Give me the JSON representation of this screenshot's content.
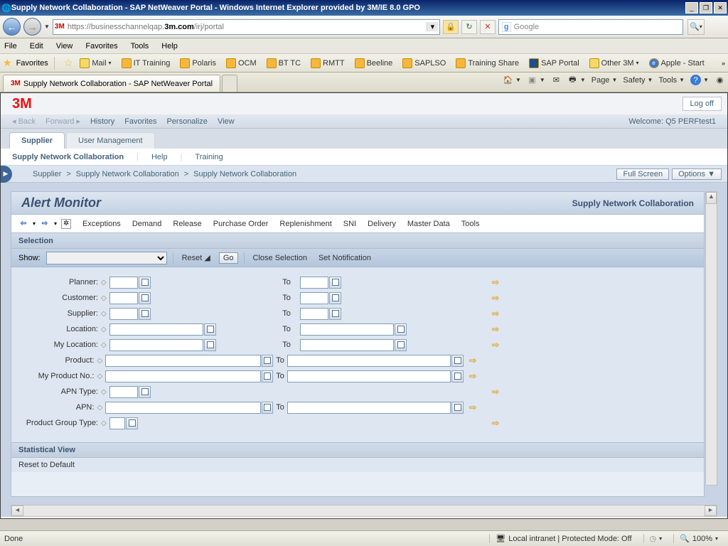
{
  "window": {
    "title": "Supply Network Collaboration - SAP NetWeaver Portal - Windows Internet Explorer provided by 3M/IE 8.0 GPO"
  },
  "address": {
    "logo_text": "3M",
    "protocol": "https://businesschannelqap.",
    "host": "3m.com",
    "path": "/irj/portal"
  },
  "search": {
    "provider": "Google",
    "glyph": "g"
  },
  "menubar": {
    "items": [
      "File",
      "Edit",
      "View",
      "Favorites",
      "Tools",
      "Help"
    ]
  },
  "favorites": {
    "label": "Favorites",
    "items": [
      "Mail",
      "IT Training",
      "Polaris",
      "OCM",
      "BT TC",
      "RMTT",
      "Beeline",
      "SAPLSO",
      "Training Share",
      "SAP Portal",
      "Other 3M",
      "Apple - Start"
    ]
  },
  "tab": {
    "title": "Supply Network Collaboration - SAP NetWeaver Portal",
    "logo": "3M"
  },
  "commandbar": {
    "page": "Page",
    "safety": "Safety",
    "tools": "Tools"
  },
  "portal": {
    "logo": "3M",
    "logoff": "Log off",
    "toolbar": {
      "back": "Back",
      "forward": "Forward",
      "history": "History",
      "favorites": "Favorites",
      "personalize": "Personalize",
      "view": "View",
      "welcome": "Welcome: Q5 PERFtest1"
    },
    "tabs": {
      "supplier": "Supplier",
      "user_mgmt": "User Management"
    },
    "subnav": {
      "snc": "Supply Network Collaboration",
      "help": "Help",
      "training": "Training"
    },
    "breadcrumb": {
      "a": "Supplier",
      "b": "Supply Network Collaboration",
      "c": "Supply Network Collaboration",
      "full": "Full Screen",
      "options": "Options"
    }
  },
  "app": {
    "title": "Alert Monitor",
    "corner": "Supply Network Collaboration",
    "menu": [
      "Exceptions",
      "Demand",
      "Release",
      "Purchase Order",
      "Replenishment",
      "SNI",
      "Delivery",
      "Master Data",
      "Tools"
    ],
    "selection_hdr": "Selection",
    "show_label": "Show:",
    "reset": "Reset",
    "go": "Go",
    "close_sel": "Close Selection",
    "set_notif": "Set Notification",
    "fields": {
      "planner": "Planner:",
      "customer": "Customer:",
      "supplier": "Supplier:",
      "location": "Location:",
      "mylocation": "My Location:",
      "product": "Product:",
      "myprodno": "My Product No.:",
      "apntype": "APN Type:",
      "apn": "APN:",
      "prodgrptype": "Product Group Type:",
      "to": "To"
    },
    "stat_hdr": "Statistical View",
    "reset_default": "Reset to Default"
  },
  "status": {
    "done": "Done",
    "zone": "Local intranet | Protected Mode: Off",
    "zoom": "100%"
  }
}
